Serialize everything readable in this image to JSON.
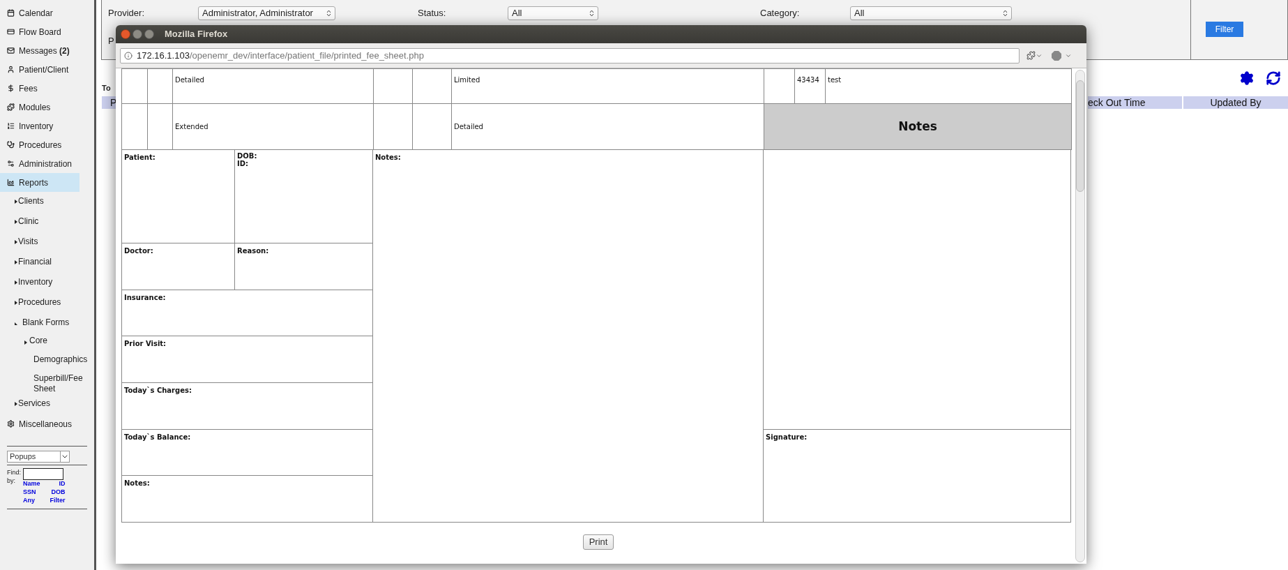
{
  "sidebar": {
    "items": [
      {
        "label": "Calendar",
        "selected": false
      },
      {
        "label": "Flow Board",
        "selected": false
      },
      {
        "label": "Messages **(2)**",
        "selected": false
      },
      {
        "label": "Patient/Client",
        "selected": false
      },
      {
        "label": "Fees",
        "selected": false
      },
      {
        "label": "Modules",
        "selected": false
      },
      {
        "label": "Inventory",
        "selected": false
      },
      {
        "label": "Procedures",
        "selected": false
      },
      {
        "label": "Administration",
        "selected": false
      },
      {
        "label": "Reports",
        "selected": true,
        "children": [
          {
            "label": "Clients",
            "expanded": false
          },
          {
            "label": "Clinic",
            "expanded": false
          },
          {
            "label": "Visits",
            "expanded": false
          },
          {
            "label": "Financial",
            "expanded": false
          },
          {
            "label": "Inventory",
            "expanded": false
          },
          {
            "label": "Procedures",
            "expanded": false
          },
          {
            "label": "Blank Forms",
            "expanded": true,
            "children": [
              {
                "label": "Core",
                "expanded": false
              },
              {
                "label": "Demographics"
              },
              {
                "label": "Superbill/Fee Sheet"
              }
            ]
          },
          {
            "label": "Services",
            "expanded": false
          }
        ]
      },
      {
        "label": "Miscellaneous",
        "selected": false
      }
    ],
    "popup_select": {
      "value": "Popups"
    },
    "find": {
      "label": "Find:",
      "by_label": "by:",
      "links": [
        "Name",
        "ID",
        "SSN",
        "DOB",
        "Any",
        "Filter"
      ]
    }
  },
  "filters": {
    "fields": [
      {
        "label": "Provider:",
        "value": "Administrator, Administrator"
      },
      {
        "label": "Status:",
        "value": "All"
      },
      {
        "label": "Category:",
        "value": "All"
      }
    ],
    "partial_label": "P",
    "button": "Filter"
  },
  "page": {
    "partial_total": "To",
    "columns": [
      "P",
      "eck Out Time",
      "Updated By"
    ]
  },
  "popup": {
    "title": "Mozilla Firefox",
    "url_host": "172.16.1.103",
    "url_path": "/openemr_dev/interface/patient_file/printed_fee_sheet.php",
    "rows": [
      [
        "",
        "",
        "Detailed",
        "",
        "",
        "Limited",
        "",
        "43434",
        "test"
      ],
      [
        "",
        "",
        "Extended",
        "",
        "",
        "Detailed"
      ]
    ],
    "notes_heading": "Notes",
    "left_fields": [
      [
        "Patient:",
        "DOB:",
        "ID:"
      ],
      [
        "Doctor:",
        "Reason:"
      ],
      [
        "Insurance:"
      ],
      [
        "Prior Visit:"
      ],
      [
        "Today`s Charges:"
      ],
      [
        "Today`s Balance:"
      ],
      [
        "Notes:"
      ]
    ],
    "middle_label": "Notes:",
    "signature_label": "Signature:",
    "print_button": "Print"
  }
}
